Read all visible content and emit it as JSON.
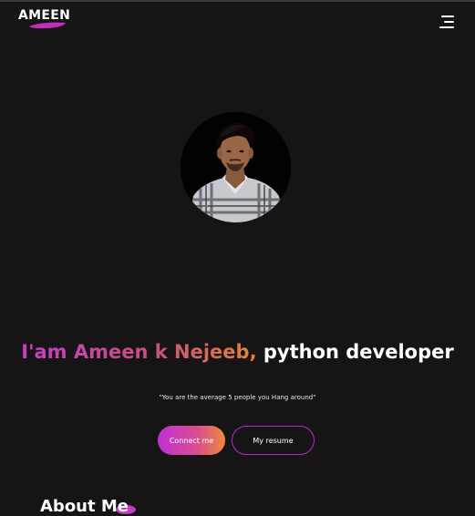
{
  "header": {
    "brand": "AMEEN",
    "menu_icon": "hamburger-menu-icon"
  },
  "hero": {
    "avatar_alt": "profile-photo",
    "name_part": "I'am Ameen k Nejeeb,",
    "role_part": "python developer",
    "quote": "\"You are the average 5 people you Hang around\"",
    "connect_label": "Connect me",
    "resume_label": "My resume"
  },
  "about": {
    "title": "About Me"
  },
  "colors": {
    "background": "#171415",
    "accent_purple": "#c22fd6",
    "accent_pink": "#d9508d",
    "accent_orange": "#ef8a39"
  }
}
